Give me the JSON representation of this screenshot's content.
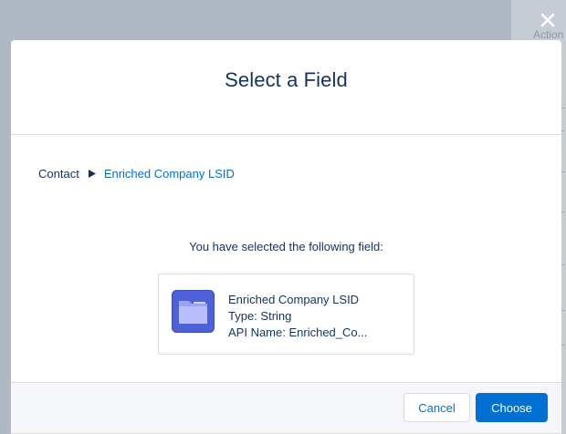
{
  "background": {
    "header_fragment": "Action I"
  },
  "modal": {
    "title": "Select a Field",
    "breadcrumb": {
      "root": "Contact",
      "selected": "Enriched Company LSID"
    },
    "selected_note": "You have selected the following field:",
    "field": {
      "name": "Enriched Company LSID",
      "type": "Type: String",
      "api_name": "API Name: Enriched_Co..."
    },
    "footer": {
      "cancel_label": "Cancel",
      "choose_label": "Choose"
    }
  },
  "colors": {
    "brand_blue": "#0070d2",
    "title_navy": "#16325c",
    "overlay": "#b0b8c3",
    "field_icon": "#4e61d8"
  },
  "icons": {
    "close": "close-icon",
    "breadcrumb_separator": "caret-right-icon",
    "field": "folder-icon"
  }
}
